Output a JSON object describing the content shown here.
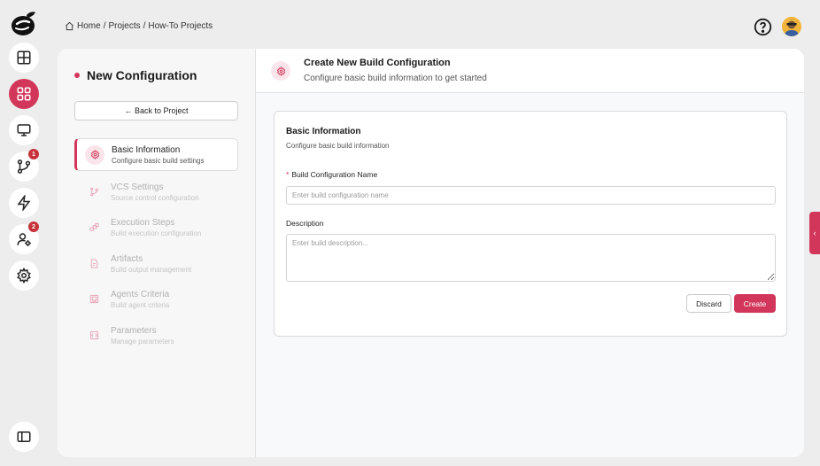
{
  "breadcrumb": {
    "home": "Home",
    "sep1": "/",
    "projects": "Projects",
    "sep2": "/",
    "current": "How-To Projects"
  },
  "rail": {
    "items": [
      {
        "icon": "layout-icon"
      },
      {
        "icon": "apps-grid-icon",
        "active": true
      },
      {
        "icon": "monitor-icon"
      },
      {
        "icon": "git-branch-icon",
        "badge": "1"
      },
      {
        "icon": "lightning-icon"
      },
      {
        "icon": "user-settings-icon",
        "badge": "2"
      },
      {
        "icon": "gear-icon"
      },
      {
        "icon": "sidebar-toggle-icon"
      }
    ]
  },
  "left_panel": {
    "title": "New Configuration",
    "back_label": "← Back to Project",
    "steps": [
      {
        "label": "Basic Information",
        "sub": "Configure basic build settings",
        "active": true
      },
      {
        "label": "VCS Settings",
        "sub": "Source control configuration"
      },
      {
        "label": "Execution Steps",
        "sub": "Build execution configuration"
      },
      {
        "label": "Artifacts",
        "sub": "Build output management"
      },
      {
        "label": "Agents Criteria",
        "sub": "Build agent criteria"
      },
      {
        "label": "Parameters",
        "sub": "Manage parameters"
      }
    ]
  },
  "header": {
    "title": "Create New Build Configuration",
    "subtitle": "Configure basic build information to get started"
  },
  "form": {
    "card_title": "Basic Information",
    "card_sub": "Configure basic build information",
    "required_mark": "*",
    "name_label": "Build Configuration Name",
    "name_value": "",
    "name_placeholder": "Enter build configuration name",
    "desc_label": "Description",
    "desc_value": "",
    "desc_placeholder": "Enter build description...",
    "discard_label": "Discard",
    "create_label": "Create"
  },
  "side_tab": {
    "label": "‹"
  },
  "colors": {
    "accent": "#d2365a",
    "badge": "#c8323a",
    "background": "#ededed"
  }
}
